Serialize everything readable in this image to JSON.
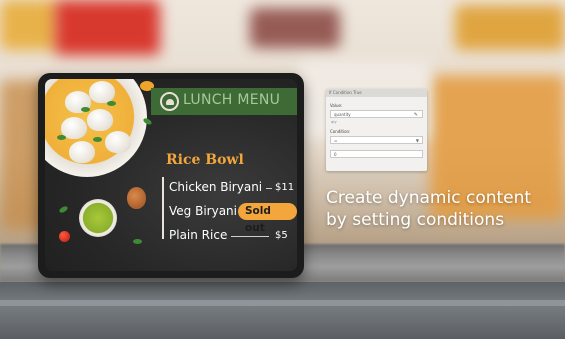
{
  "menu": {
    "banner_title": "LUNCH MENU",
    "section_title": "Rice Bowl",
    "items": [
      {
        "name": "Chicken Biryani",
        "price": "$11"
      },
      {
        "name": "Veg Biryani",
        "badge": "Sold out"
      },
      {
        "name": "Plain Rice",
        "price": "$5"
      }
    ]
  },
  "condition_panel": {
    "header": "If Condition True",
    "value_label": "Value:",
    "value_input": "quantity",
    "value_hint": "qty",
    "condition_label": "Condition:",
    "condition_select": "=",
    "target_input": "0"
  },
  "caption": {
    "line1": "Create dynamic content",
    "line2": "by setting conditions"
  },
  "colors": {
    "accent_orange": "#f2a63c",
    "banner_green": "#3e6b35",
    "chalkboard": "#262626"
  },
  "icons": {
    "menu_logo": "chef-hat-icon",
    "edit": "pencil-icon",
    "dropdown": "chevron-down-icon"
  }
}
